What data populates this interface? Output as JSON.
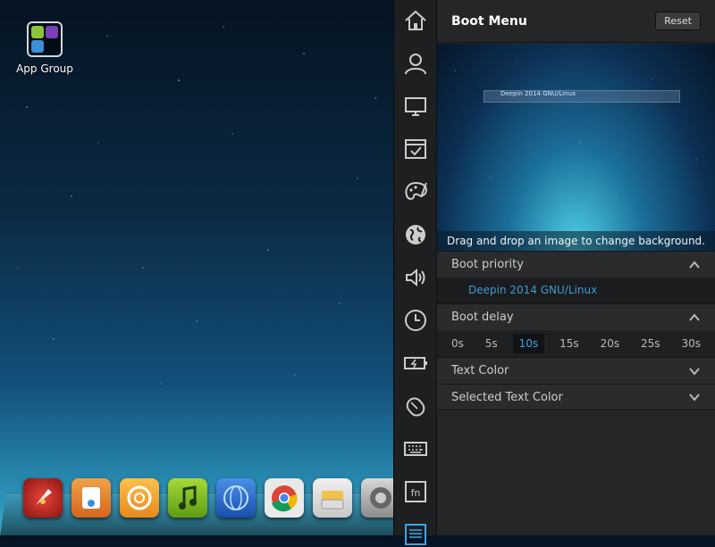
{
  "desktop": {
    "app_group_label": "App Group"
  },
  "dock": {
    "items": [
      {
        "name": "rocket",
        "color": "#c8281f"
      },
      {
        "name": "store",
        "color": "#e8843a"
      },
      {
        "name": "spiral",
        "color": "#f0a234"
      },
      {
        "name": "music",
        "color": "#8fc42a"
      },
      {
        "name": "browser-globe",
        "color": "#2a6fd6"
      },
      {
        "name": "chrome",
        "color": "#e8e8e8"
      },
      {
        "name": "files",
        "color": "#d8d8d8"
      },
      {
        "name": "settings",
        "color": "#9a9a9a"
      }
    ]
  },
  "sidebar": {
    "icons": [
      "home-icon",
      "user-icon",
      "monitor-icon",
      "window-check-icon",
      "palette-icon",
      "globe-icon",
      "speaker-icon",
      "clock-icon",
      "battery-icon",
      "mouse-icon",
      "keyboard-icon",
      "fn-icon",
      "list-icon"
    ]
  },
  "panel": {
    "title": "Boot Menu",
    "reset_label": "Reset",
    "preview": {
      "entry_text": "Deepin 2014 GNU/Linux",
      "hint": "Drag and drop an image to change background."
    },
    "boot_priority": {
      "label": "Boot priority",
      "items": [
        "Deepin 2014 GNU/Linux"
      ]
    },
    "boot_delay": {
      "label": "Boot delay",
      "options": [
        "0s",
        "5s",
        "10s",
        "15s",
        "20s",
        "25s",
        "30s"
      ],
      "selected": "10s"
    },
    "text_color_label": "Text Color",
    "selected_text_color_label": "Selected Text Color"
  },
  "colors": {
    "accent": "#3da4e6",
    "panel_bg": "#252627"
  }
}
